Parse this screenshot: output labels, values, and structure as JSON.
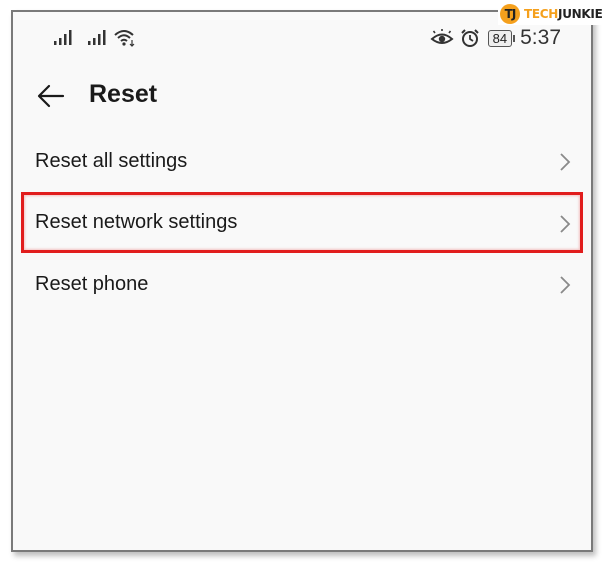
{
  "watermark": {
    "brand_part1": "TECH",
    "brand_part2": "JUNKIE",
    "mark_letters": "TJ"
  },
  "status_bar": {
    "icons": [
      "signal-icon",
      "signal-icon",
      "wifi-icon",
      "eye-comfort-icon",
      "alarm-icon"
    ],
    "battery": "84",
    "time": "5:37"
  },
  "header": {
    "back_icon": "back-arrow-icon",
    "title": "Reset"
  },
  "menu": {
    "items": [
      {
        "label": "Reset all settings",
        "icon": "chevron-right-icon",
        "highlighted": false
      },
      {
        "label": "Reset network settings",
        "icon": "chevron-right-icon",
        "highlighted": true
      },
      {
        "label": "Reset phone",
        "icon": "chevron-right-icon",
        "highlighted": false
      }
    ]
  },
  "colors": {
    "highlight_border": "#e11d1d",
    "brand_orange": "#f5a01c",
    "background": "#f9f9f9"
  }
}
